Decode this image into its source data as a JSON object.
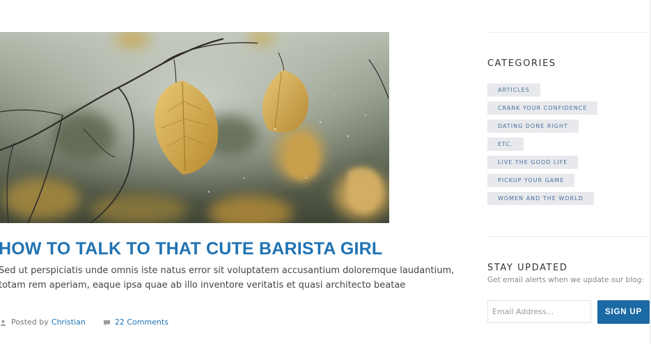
{
  "post": {
    "title": "HOW TO TALK TO THAT CUTE BARISTA GIRL",
    "excerpt_line1": "Sed ut perspiciatis unde omnis iste natus error sit voluptatem accusantium doloremque laudantium,",
    "excerpt_line2": "totam rem aperiam, eaque ipsa quae ab illo inventore veritatis et quasi architecto beatae",
    "posted_by": "Posted by",
    "author": "Christian",
    "comments": "22 Comments",
    "image": "autumn-leaves-photo"
  },
  "sidebar": {
    "categories_title": "CATEGORIES",
    "categories": [
      "ARTICLES",
      "CRANK YOUR CONFIDENCE",
      "DATING DONE RIGHT",
      "ETC.",
      "LIVE THE GOOD LIFE",
      "PICKUP YOUR GAME",
      "WOMEN AND THE WORLD"
    ],
    "newsletter": {
      "title": "STAY UPDATED",
      "description": "Get email alerts when we update our blog:",
      "email_placeholder": "Email Address...",
      "button_label": "SIGN UP"
    }
  },
  "colors": {
    "link": "#2073b3",
    "button": "#1c6aa5",
    "tag_bg": "#e7e9ec"
  }
}
